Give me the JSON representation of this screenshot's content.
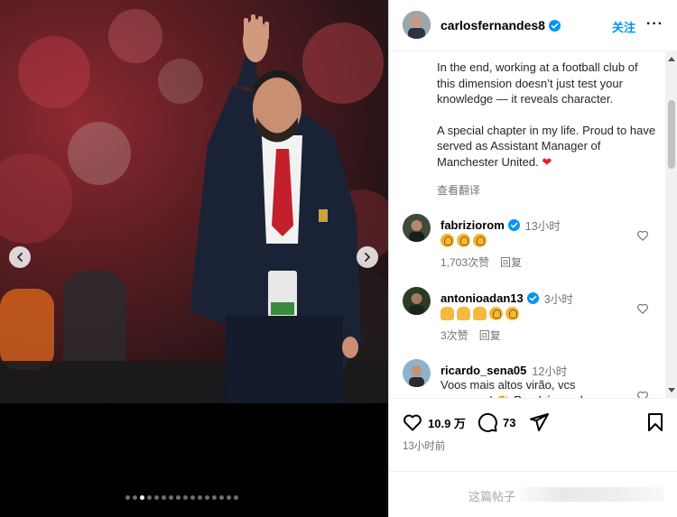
{
  "media": {
    "nav_prev_icon": "chevron-left-icon",
    "nav_next_icon": "chevron-right-icon",
    "carousel_count": 16,
    "carousel_active_index": 2
  },
  "post_header": {
    "username": "carlosfernandes8",
    "verified": true,
    "follow_label": "关注",
    "more_label": "···"
  },
  "caption": {
    "paragraph_1": "In the end, working at a football club of this dimension doesn’t just test your knowledge — it reveals character.",
    "paragraph_2": "A special chapter in my life. Proud to have served as Assistant Manager of Manchester United.",
    "paragraph_2_emoji": "❤",
    "see_translation": "查看翻译"
  },
  "comments": [
    {
      "username": "fabriziorom",
      "verified": true,
      "time": "13小时",
      "text": "",
      "emoji": [
        "clap",
        "clap",
        "clap"
      ],
      "likes": "1,703次赞",
      "reply": "回复"
    },
    {
      "username": "antonioadan13",
      "verified": true,
      "time": "3小时",
      "text": "",
      "emoji": [
        "pray",
        "pray",
        "pray",
        "clap",
        "clap"
      ],
      "likes": "3次赞",
      "reply": "回复"
    },
    {
      "username": "ricardo_sena05",
      "verified": false,
      "time": "12小时",
      "text": "Voos mais altos virão, vcs merecem! 👏 Parabéns pelo",
      "emoji": [],
      "likes": "",
      "reply": ""
    }
  ],
  "actions": {
    "like_count": "10.9 万",
    "comment_count": "73",
    "post_time": "13小时前",
    "comment_placeholder": "这篇帖子"
  },
  "colors": {
    "accent": "#0095f6",
    "heart": "#e8212b",
    "muted_text": "#737373"
  }
}
